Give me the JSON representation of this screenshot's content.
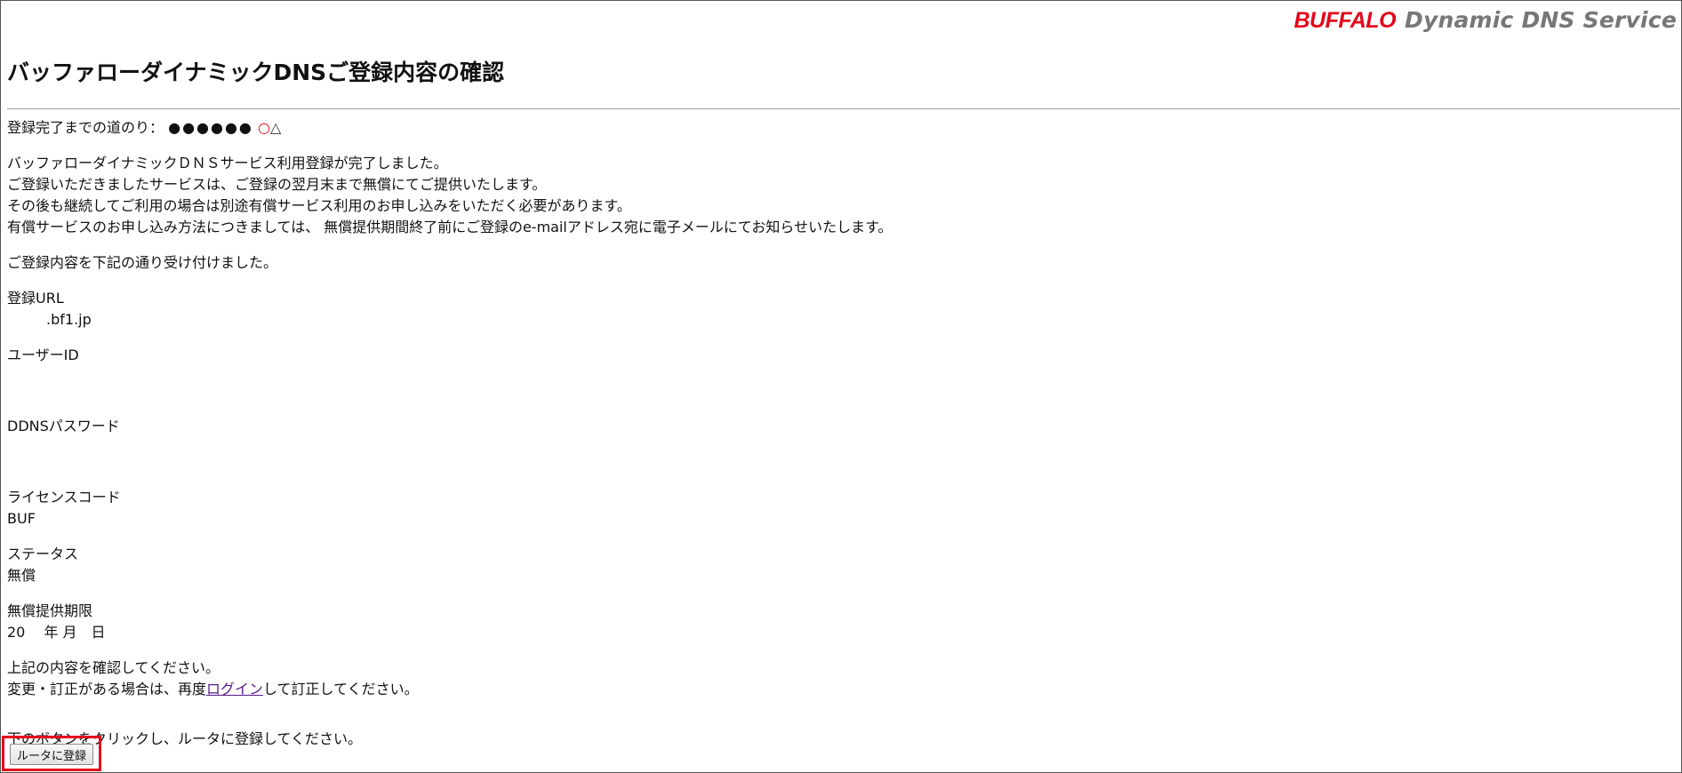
{
  "header": {
    "brand_logo": "BUFFALO",
    "brand_tagline": "Dynamic DNS Service",
    "page_title": "バッファローダイナミックDNSご登録内容の確認"
  },
  "progress": {
    "label": "登録完了までの道のり：",
    "completed_marks": "●●●●●●",
    "current_mark": "○",
    "pending_mark": "△",
    "current_color": "#e3051b"
  },
  "intro": {
    "lines": [
      "バッファローダイナミックＤＮＳサービス利用登録が完了しました。",
      "ご登録いただきましたサービスは、ご登録の翌月末まで無償にてご提供いたします。",
      "その後も継続してご利用の場合は別途有償サービス利用のお申し込みをいただく必要があります。",
      "有償サービスのお申し込み方法につきましては、 無償提供期間終了前にご登録のe-mailアドレス宛に電子メールにてお知らせいたします。"
    ],
    "received": "ご登録内容を下記の通り受け付けました。"
  },
  "details": {
    "url_label": "登録URL",
    "url_value": ".bf1.jp",
    "user_id_label": "ユーザーID",
    "user_id_value": "",
    "ddns_password_label": "DDNSパスワード",
    "ddns_password_value": "",
    "license_label": "ライセンスコード",
    "license_value": "BUF",
    "status_label": "ステータス",
    "status_value": "無償",
    "expiry_label": "無償提供期限",
    "expiry_value": "20　 年 月　日"
  },
  "confirm": {
    "line1": "上記の内容を確認してください。",
    "line2_prefix": "変更・訂正がある場合は、再度",
    "login_link": "ログイン",
    "line2_suffix": "して訂正してください。",
    "instruction": "下のボタンをクリックし、ルータに登録してください。",
    "register_button": "ルータに登録"
  },
  "colors": {
    "brand_red": "#e3051b",
    "link": "#551a8b",
    "highlight_border": "#e3051b"
  }
}
